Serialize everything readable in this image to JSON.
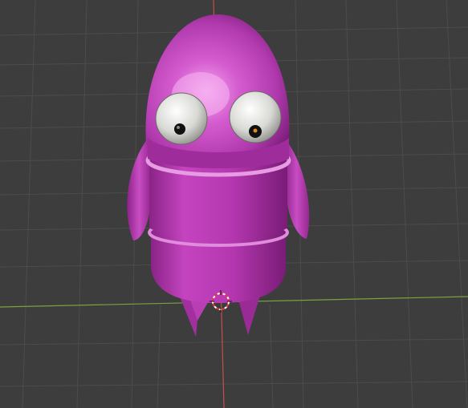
{
  "viewport": {
    "background_color": "#3d3d3d",
    "grid_color": "#4c4c4c",
    "x_axis_color": "#7ba23f",
    "y_axis_color": "#c94c52"
  },
  "scene_object": {
    "type": "purple-robot-character",
    "body_color": "#b637b2",
    "highlight_color": "#f7a8ee",
    "eye_count": 2
  },
  "cursor": {
    "type": "3d-cursor-icon",
    "colors": [
      "#ffffff",
      "#e03b3b"
    ]
  }
}
